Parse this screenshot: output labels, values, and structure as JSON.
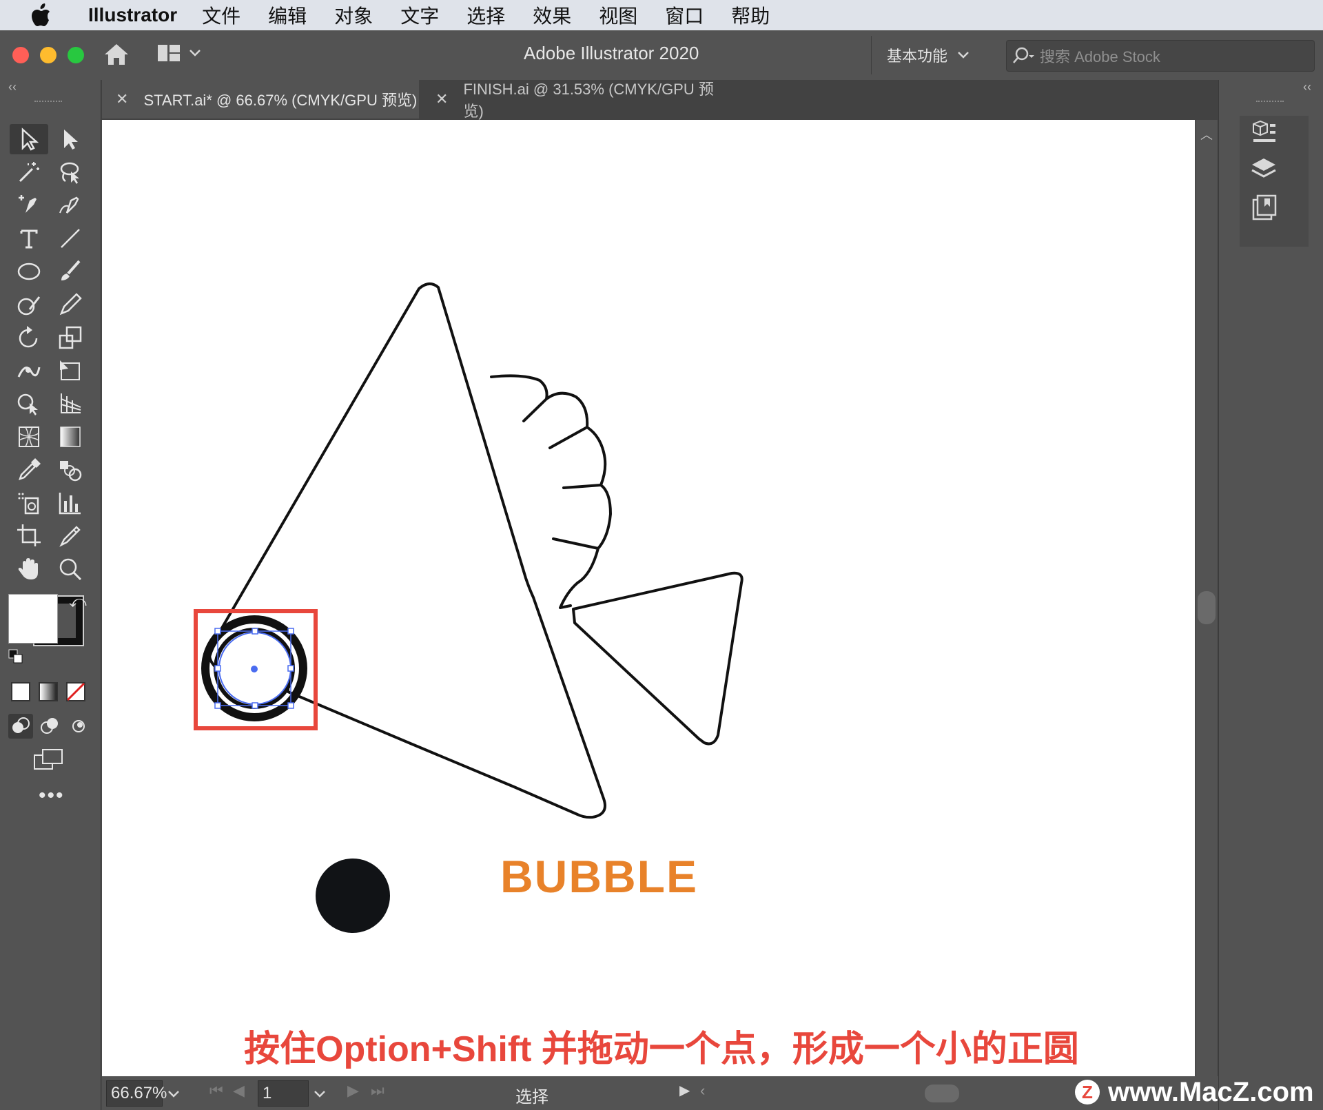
{
  "menubar": {
    "app_name": "Illustrator",
    "items": [
      "文件",
      "编辑",
      "对象",
      "文字",
      "选择",
      "效果",
      "视图",
      "窗口",
      "帮助"
    ]
  },
  "titlebar": {
    "title": "Adobe Illustrator 2020",
    "workspace": "基本功能",
    "search_placeholder": "搜索 Adobe Stock"
  },
  "tabs": [
    {
      "label": "START.ai* @ 66.67% (CMYK/GPU 预览)",
      "active": true
    },
    {
      "label": "FINISH.ai @ 31.53% (CMYK/GPU 预览)",
      "active": false
    }
  ],
  "canvas": {
    "text_label": "BUBBLE",
    "text_color": "#e8822a"
  },
  "statusbar": {
    "zoom": "66.67%",
    "artboard": "1",
    "tool_name": "选择"
  },
  "caption": "按住Option+Shift 并拖动一个点，形成一个小的正圆",
  "watermark": "www.MacZ.com",
  "watermark_logo": "Z",
  "colors": {
    "selection": "#4a6cf0",
    "highlight_box": "#e8473c",
    "traffic_red": "#ff5f57",
    "traffic_yellow": "#febc2e",
    "traffic_green": "#28c840"
  }
}
